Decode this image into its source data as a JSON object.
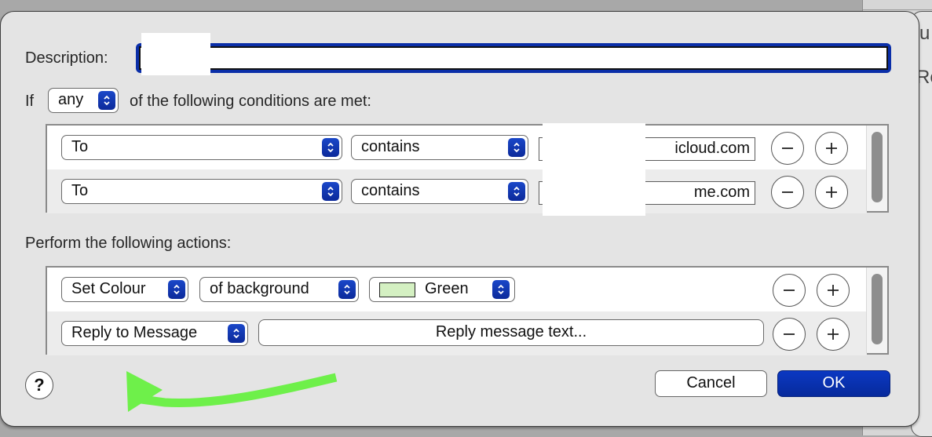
{
  "background_window": {
    "partial_texts": [
      "u",
      "Re"
    ]
  },
  "dialog": {
    "description_label": "Description:",
    "description_value": "",
    "if_label": "If",
    "match_mode": "any",
    "conditions_suffix": "of the following conditions are met:",
    "conditions": [
      {
        "field": "To",
        "operator": "contains",
        "value_visible": "@icloud.com",
        "value_display": "icloud.com"
      },
      {
        "field": "To",
        "operator": "contains",
        "value_visible": "@me.com",
        "value_display": "me.com"
      }
    ],
    "actions_label": "Perform the following actions:",
    "actions": [
      {
        "action": "Set Colour",
        "target": "of background",
        "colour_name": "Green",
        "colour_swatch": "#d4f0c2"
      },
      {
        "action": "Reply to Message",
        "button_label": "Reply message text..."
      }
    ],
    "help_label": "?",
    "cancel_label": "Cancel",
    "ok_label": "OK"
  },
  "annotation": {
    "type": "arrow",
    "color": "#6ef04a",
    "points_to": "Reply to Message action"
  },
  "colors": {
    "accent": "#0a2ea8",
    "sheet_background": "#e4e4e4"
  }
}
